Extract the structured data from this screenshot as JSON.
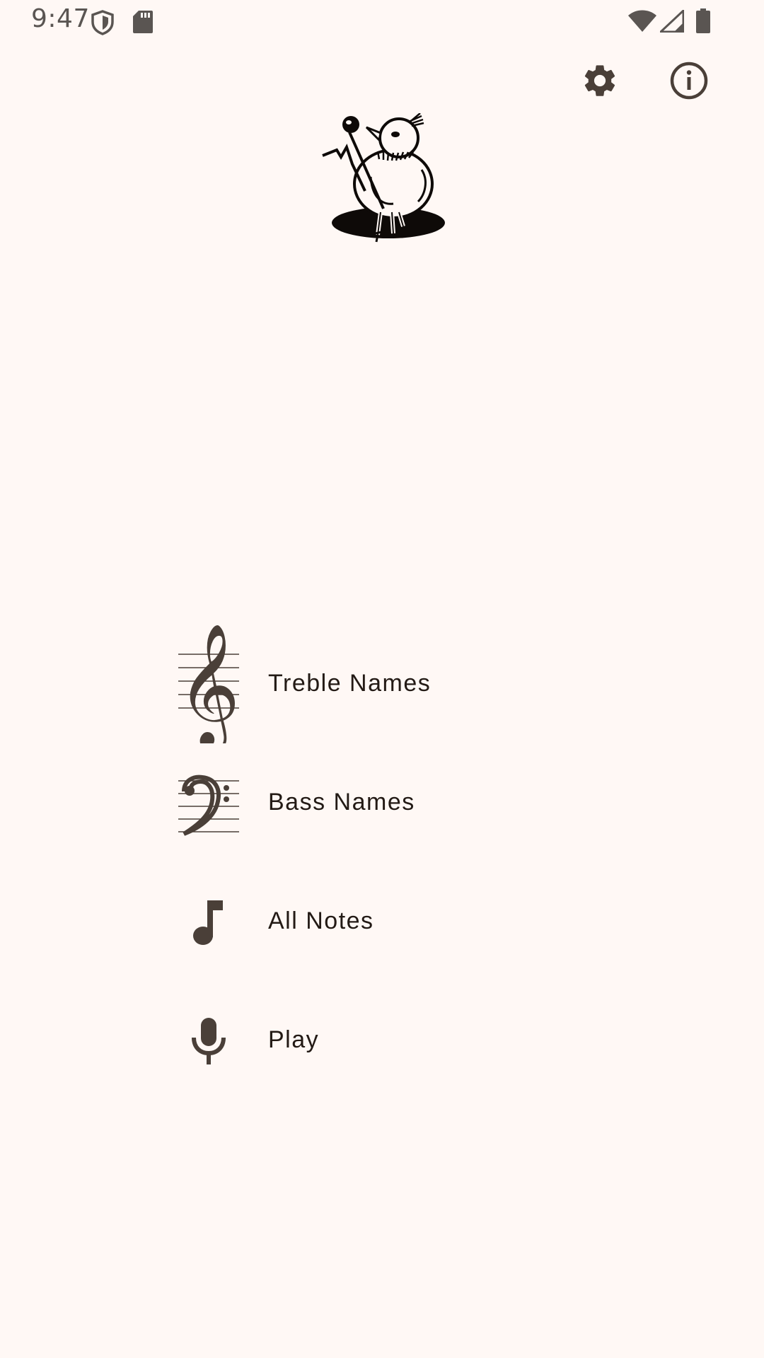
{
  "status_bar": {
    "time": "9:47",
    "icons": [
      "shield-icon",
      "sd-card-icon",
      "wifi-icon",
      "signal-icon",
      "battery-icon"
    ]
  },
  "toolbar": {
    "actions": [
      {
        "name": "settings",
        "icon": "gear-icon"
      },
      {
        "name": "info",
        "icon": "info-icon"
      }
    ]
  },
  "logo": {
    "icon": "bird-singer-logo"
  },
  "menu": {
    "items": [
      {
        "label": "Treble Names",
        "icon": "treble-clef-icon"
      },
      {
        "label": "Bass Names",
        "icon": "bass-clef-icon"
      },
      {
        "label": "All Notes",
        "icon": "music-note-icon"
      },
      {
        "label": "Play",
        "icon": "microphone-icon"
      }
    ]
  },
  "colors": {
    "background": "#fff8f5",
    "icon": "#4a3f38",
    "text": "#231a15",
    "status": "#5a5552"
  }
}
